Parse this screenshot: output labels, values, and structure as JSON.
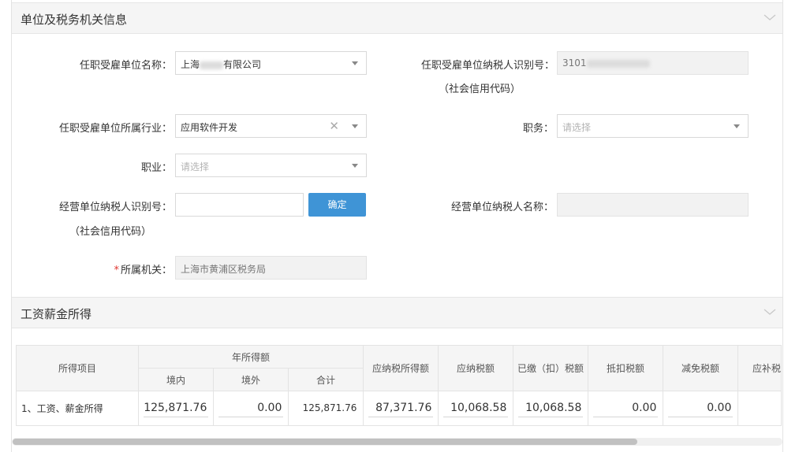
{
  "sections": {
    "unit_info": {
      "title": "单位及税务机关信息"
    },
    "salary": {
      "title": "工资薪金所得"
    }
  },
  "form": {
    "employer_name": {
      "label": "任职受雇单位名称：",
      "value_prefix": "上海",
      "value_suffix": "有限公司"
    },
    "employer_taxid": {
      "label": "任职受雇单位纳税人识别号：",
      "sublabel": "（社会信用代码）",
      "value_prefix": "3101"
    },
    "employer_industry": {
      "label": "任职受雇单位所属行业：",
      "value": "应用软件开发"
    },
    "position": {
      "label": "职务：",
      "placeholder": "请选择"
    },
    "occupation": {
      "label": "职业：",
      "placeholder": "请选择"
    },
    "business_taxid": {
      "label": "经营单位纳税人识别号：",
      "sublabel": "（社会信用代码）",
      "value": ""
    },
    "confirm_button": "确定",
    "business_name": {
      "label": "经营单位纳税人名称：",
      "value": ""
    },
    "tax_authority": {
      "required_mark": "*",
      "label": "所属机关：",
      "value": "上海市黄浦区税务局"
    }
  },
  "table": {
    "headers": {
      "item": "所得项目",
      "annual_income": "年所得额",
      "domestic": "境内",
      "overseas": "境外",
      "total": "合计",
      "taxable_income": "应纳税所得额",
      "tax_payable": "应纳税额",
      "tax_paid": "已缴（扣）税额",
      "tax_credit": "抵扣税额",
      "tax_reduction": "减免税额",
      "tax_due": "应补税"
    },
    "rows": [
      {
        "item": "1、工资、薪金所得",
        "domestic": "125,871.76",
        "overseas": "0.00",
        "total": "125,871.76",
        "taxable_income": "87,371.76",
        "tax_payable": "10,068.58",
        "tax_paid": "10,068.58",
        "tax_credit": "0.00",
        "tax_reduction": "0.00"
      }
    ]
  }
}
